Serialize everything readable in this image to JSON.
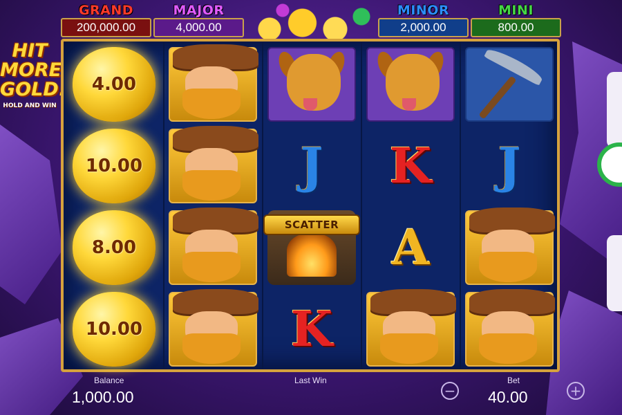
{
  "logo": {
    "lines": [
      "HIT",
      "MORE",
      "GOLD!"
    ],
    "subtitle": "HOLD AND WIN"
  },
  "jackpots": {
    "grand": {
      "name": "GRAND",
      "value": "200,000.00",
      "color": "#ff3a2a"
    },
    "major": {
      "name": "MAJOR",
      "value": "4,000.00",
      "color": "#e25bff"
    },
    "minor": {
      "name": "MINOR",
      "value": "2,000.00",
      "color": "#2c8dff"
    },
    "mini": {
      "name": "MINI",
      "value": "800.00",
      "color": "#46d646"
    }
  },
  "reels": [
    [
      {
        "symbol": "gold-nugget",
        "value": "4.00"
      },
      {
        "symbol": "gold-nugget",
        "value": "10.00"
      },
      {
        "symbol": "gold-nugget",
        "value": "8.00"
      },
      {
        "symbol": "gold-nugget",
        "value": "10.00"
      }
    ],
    [
      {
        "symbol": "miner"
      },
      {
        "symbol": "miner"
      },
      {
        "symbol": "miner"
      },
      {
        "symbol": "miner"
      }
    ],
    [
      {
        "symbol": "dog"
      },
      {
        "symbol": "letter",
        "text": "J"
      },
      {
        "symbol": "scatter",
        "text": "SCATTER"
      },
      {
        "symbol": "letter",
        "text": "K"
      }
    ],
    [
      {
        "symbol": "dog"
      },
      {
        "symbol": "letter",
        "text": "K"
      },
      {
        "symbol": "letter",
        "text": "A"
      },
      {
        "symbol": "miner"
      }
    ],
    [
      {
        "symbol": "pickaxe"
      },
      {
        "symbol": "letter",
        "text": "J"
      },
      {
        "symbol": "miner"
      },
      {
        "symbol": "miner"
      }
    ]
  ],
  "footer": {
    "balance_label": "Balance",
    "balance_value": "1,000.00",
    "last_win_label": "Last Win",
    "bet_label": "Bet",
    "bet_value": "40.00",
    "decrease_symbol": "−",
    "increase_symbol": "+"
  },
  "colors": {
    "frame": "#d6a23d",
    "reel_bg": "#0d2466",
    "spin_ring": "#2bb34a"
  }
}
